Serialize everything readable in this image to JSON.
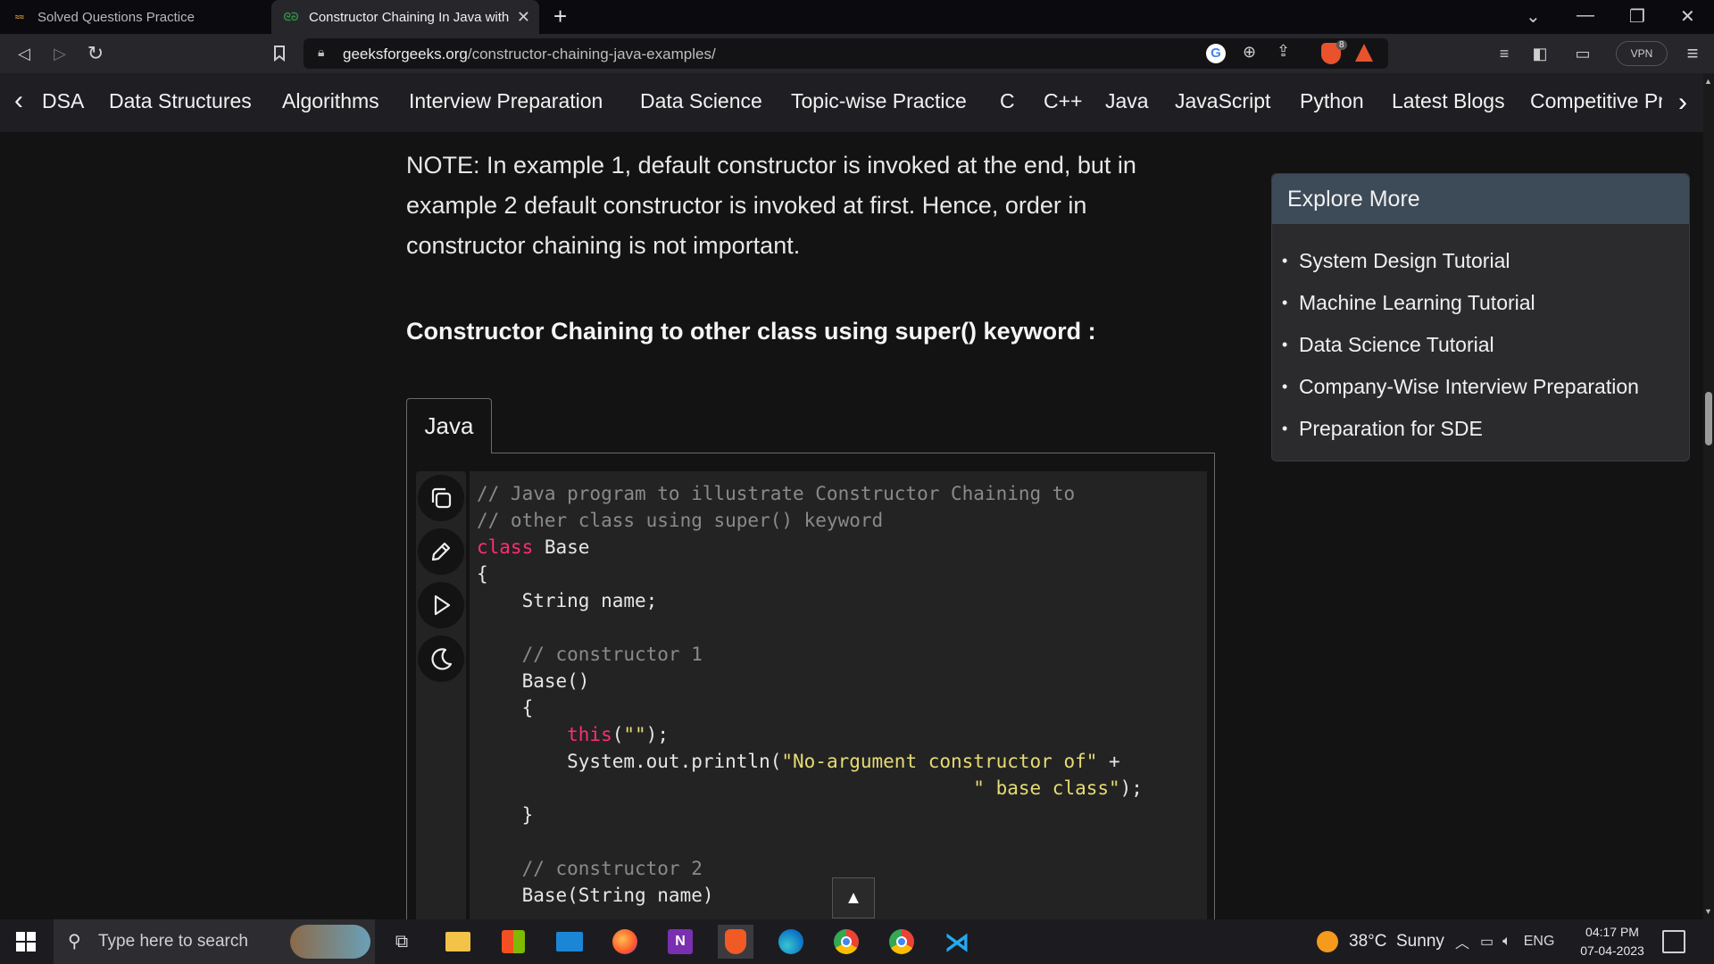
{
  "browser": {
    "tabs": [
      {
        "title": "Solved Questions Practice",
        "favicon": "coding-ninjas-icon"
      },
      {
        "title": "Constructor Chaining In Java with",
        "favicon": "gfg-icon",
        "active": true
      }
    ],
    "url_host": "geeksforgeeks.org",
    "url_path": "/constructor-chaining-java-examples/",
    "vpn_label": "VPN",
    "brave_badge": "8"
  },
  "nav": {
    "items": [
      "DSA",
      "Data Structures",
      "Algorithms",
      "Interview Preparation",
      "Data Science",
      "Topic-wise Practice",
      "C",
      "C++",
      "Java",
      "JavaScript",
      "Python",
      "Latest Blogs",
      "Competitive Pr"
    ]
  },
  "article": {
    "note": "NOTE: In example 1, default constructor is invoked at the end, but in example 2 default constructor is invoked at first. Hence, order in constructor chaining is not important.",
    "heading": "Constructor Chaining to other class using super() keyword :",
    "code_tab": "Java",
    "code_lines": [
      [
        {
          "t": "c",
          "v": "// Java program to illustrate Constructor Chaining to"
        }
      ],
      [
        {
          "t": "c",
          "v": "// other class using super() keyword"
        }
      ],
      [
        {
          "t": "k",
          "v": "class"
        },
        {
          "t": "p",
          "v": " Base"
        }
      ],
      [
        {
          "t": "p",
          "v": "{"
        }
      ],
      [
        {
          "t": "p",
          "v": "    String name;"
        }
      ],
      [
        {
          "t": "p",
          "v": ""
        }
      ],
      [
        {
          "t": "c",
          "v": "    // constructor 1"
        }
      ],
      [
        {
          "t": "p",
          "v": "    Base()"
        }
      ],
      [
        {
          "t": "p",
          "v": "    {"
        }
      ],
      [
        {
          "t": "k",
          "v": "        this"
        },
        {
          "t": "p",
          "v": "("
        },
        {
          "t": "s",
          "v": "\"\""
        },
        {
          "t": "p",
          "v": ");"
        }
      ],
      [
        {
          "t": "p",
          "v": "        System.out.println("
        },
        {
          "t": "s",
          "v": "\"No-argument constructor of\""
        },
        {
          "t": "p",
          "v": " +"
        }
      ],
      [
        {
          "t": "s",
          "v": "                                            \" base class\""
        },
        {
          "t": "p",
          "v": ");"
        }
      ],
      [
        {
          "t": "p",
          "v": "    }"
        }
      ],
      [
        {
          "t": "p",
          "v": ""
        }
      ],
      [
        {
          "t": "c",
          "v": "    // constructor 2"
        }
      ],
      [
        {
          "t": "p",
          "v": "    Base(String name)"
        }
      ]
    ],
    "scroll_top_label": "▲"
  },
  "explore": {
    "title": "Explore More",
    "items": [
      "System Design Tutorial",
      "Machine Learning Tutorial",
      "Data Science Tutorial",
      "Company-Wise Interview Preparation",
      "Preparation for SDE"
    ]
  },
  "taskbar": {
    "search_placeholder": "Type here to search",
    "weather": "38°C  Sunny",
    "language": "ENG",
    "time": "04:17 PM",
    "date": "07-04-2023",
    "apps": [
      "task-view-icon",
      "file-explorer-icon",
      "microsoft-store-icon",
      "mail-icon",
      "firefox-icon",
      "onenote-icon",
      "brave-icon",
      "edge-icon",
      "chrome-icon",
      "chrome-profile-icon",
      "vscode-icon"
    ]
  },
  "colors": {
    "keyword": "#ff2d72",
    "string": "#e6db74",
    "comment": "#8a8a8a",
    "explore_header": "#3d4a58",
    "page_bg": "#131313"
  }
}
